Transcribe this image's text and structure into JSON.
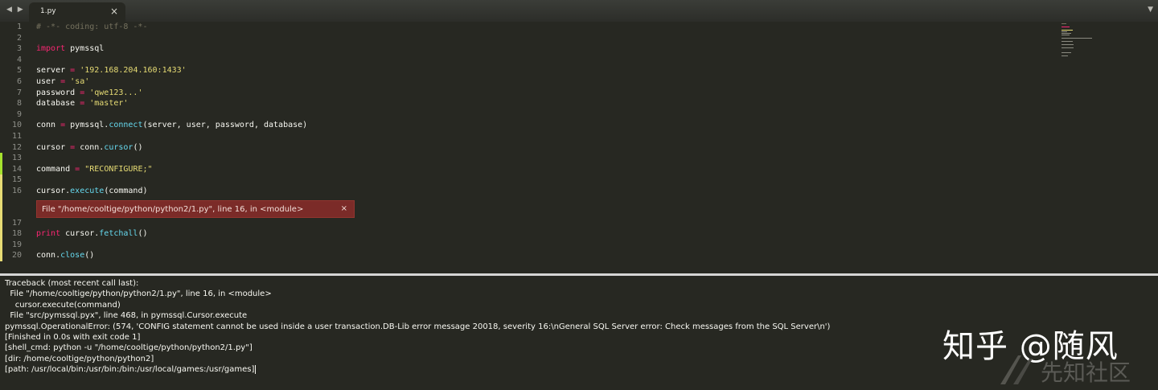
{
  "tabbar": {
    "nav_label": "◀ ▶",
    "tab": {
      "label": "1.py",
      "close": "×"
    },
    "dropdown": "▼"
  },
  "editor": {
    "lines": [
      {
        "n": "1",
        "html": "<span class=\"c-comment\"># -*- coding: utf-8 -*-</span>"
      },
      {
        "n": "2",
        "html": ""
      },
      {
        "n": "3",
        "html": "<span class=\"c-kw\">import</span> pymssql"
      },
      {
        "n": "4",
        "html": ""
      },
      {
        "n": "5",
        "html": "server <span class=\"c-op\">=</span> <span class=\"c-str\">'192.168.204.160:1433'</span>"
      },
      {
        "n": "6",
        "html": "user <span class=\"c-op\">=</span> <span class=\"c-str\">'sa'</span>"
      },
      {
        "n": "7",
        "html": "password <span class=\"c-op\">=</span> <span class=\"c-str\">'qwe123...'</span>"
      },
      {
        "n": "8",
        "html": "database <span class=\"c-op\">=</span> <span class=\"c-str\">'master'</span>"
      },
      {
        "n": "9",
        "html": ""
      },
      {
        "n": "10",
        "html": "conn <span class=\"c-op\">=</span> pymssql.<span class=\"c-fn\">connect</span>(server, user, password, database)"
      },
      {
        "n": "11",
        "html": ""
      },
      {
        "n": "12",
        "html": "cursor <span class=\"c-op\">=</span> conn.<span class=\"c-fn\">cursor</span>()"
      },
      {
        "n": "13",
        "html": ""
      },
      {
        "n": "14",
        "html": "command <span class=\"c-op\">=</span> <span class=\"c-str\">\"RECONFIGURE;\"</span>"
      },
      {
        "n": "15",
        "html": ""
      },
      {
        "n": "16",
        "html": "cursor.<span class=\"c-fn\">execute</span>(command)"
      },
      {
        "n": "17",
        "html": ""
      },
      {
        "n": "18",
        "html": "<span class=\"c-kw\">print</span> cursor.<span class=\"c-fn\">fetchall</span>()"
      },
      {
        "n": "19",
        "html": ""
      },
      {
        "n": "20",
        "html": "conn.<span class=\"c-fn\">close</span>()"
      }
    ],
    "error_popup": {
      "text": "File \"/home/cooltige/python/python2/1.py\", line 16, in <module>",
      "close": "×"
    }
  },
  "console": {
    "lines": [
      "Traceback (most recent call last):",
      "  File \"/home/cooltige/python/python2/1.py\", line 16, in <module>",
      "    cursor.execute(command)",
      "  File \"src/pymssql.pyx\", line 468, in pymssql.Cursor.execute",
      "pymssql.OperationalError: (574, 'CONFIG statement cannot be used inside a user transaction.DB-Lib error message 20018, severity 16:\\nGeneral SQL Server error: Check messages from the SQL Server\\n')",
      "[Finished in 0.0s with exit code 1]",
      "[shell_cmd: python -u \"/home/cooltige/python/python2/1.py\"]",
      "[dir: /home/cooltige/python/python2]",
      "[path: /usr/local/bin:/usr/bin:/bin:/usr/local/games:/usr/games]"
    ]
  },
  "watermarks": {
    "zhihu": "知乎 @随风",
    "xianzhi": "先知社区"
  },
  "colors": {
    "background": "#272822",
    "keyword": "#f92672",
    "string": "#e6db74",
    "function": "#66d9ef",
    "comment": "#75715e",
    "error_bg": "#7b2b28"
  }
}
